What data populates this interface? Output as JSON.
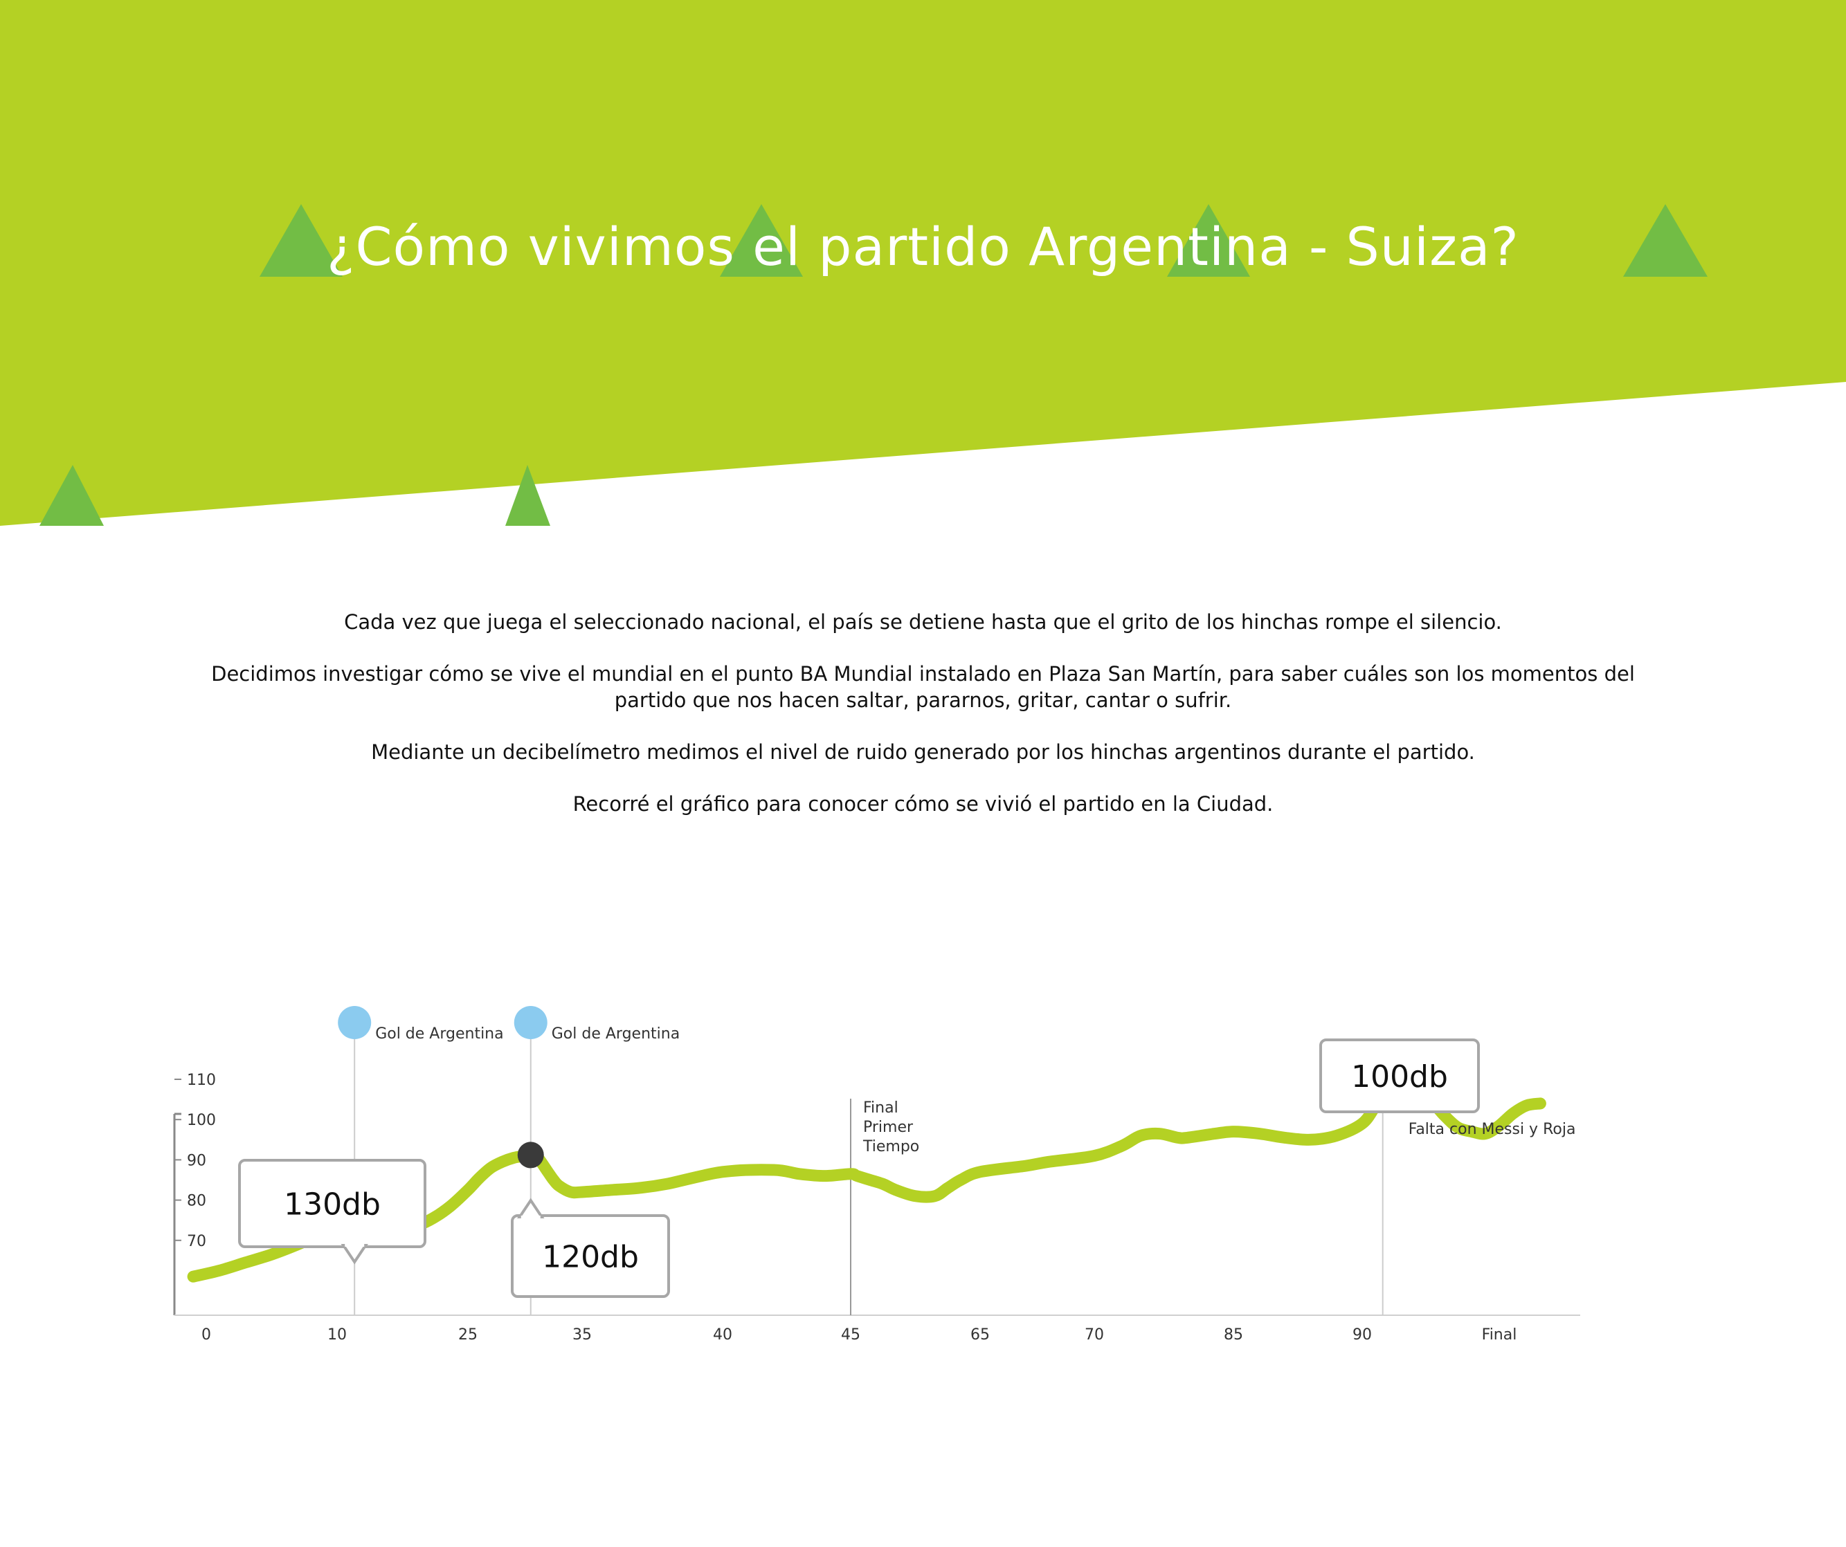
{
  "page": {
    "title": "¿Cómo vivimos el partido Argentina - Suiza?",
    "intro": [
      "Cada vez que juega el seleccionado nacional, el país se detiene hasta que el grito de los hinchas rompe el silencio.",
      "Decidimos investigar cómo se vive el mundial en el punto BA Mundial instalado en Plaza San Martín, para saber cuáles son los momentos del partido que nos hacen saltar, pararnos, gritar, cantar o sufrir.",
      "Mediante un decibelímetro medimos el nivel de ruido generado por los hinchas argentinos durante el partido.",
      "Recorré el gráfico para conocer cómo se vivió el partido en la Ciudad."
    ]
  },
  "colors": {
    "banner": "#b4d124",
    "triangle": "#72bd45",
    "line": "#b4d124",
    "goal_marker": "#8bcbef",
    "point_marker": "#3a3a3a",
    "foul_marker": "#d1213b",
    "callout_border": "#a7a7a7",
    "axis": "#888888",
    "gridline": "#cccccc"
  },
  "chart_data": {
    "type": "line",
    "title": "",
    "xlabel": "",
    "ylabel": "",
    "x_ticks": [
      "0",
      "10",
      "25",
      "35",
      "40",
      "45",
      "65",
      "70",
      "85",
      "90",
      "Final"
    ],
    "y_ticks": [
      "70",
      "80",
      "90",
      "100",
      "110"
    ],
    "ylim": [
      60,
      110
    ],
    "series": [
      {
        "x": [
          -1,
          1,
          3,
          5,
          7,
          8,
          9,
          9.5,
          10,
          11,
          12,
          13,
          15,
          17,
          19,
          21,
          23,
          25,
          26,
          27,
          28,
          29,
          30,
          30.5,
          31,
          32,
          32.5,
          33,
          34,
          35,
          36,
          37,
          38,
          40,
          42,
          43,
          44,
          45,
          46,
          48,
          50,
          52,
          55,
          58,
          60,
          62,
          65,
          67,
          68,
          70,
          73,
          75,
          77,
          79,
          80,
          83,
          85,
          86,
          87,
          88,
          89,
          90,
          91,
          92,
          93,
          94,
          95,
          96,
          97,
          98,
          99,
          100,
          101,
          102,
          103
        ],
        "values": [
          61,
          62.5,
          64.5,
          66.5,
          69,
          70.5,
          72,
          73,
          74,
          75.5,
          76,
          75.5,
          73.5,
          72.5,
          73.5,
          75.5,
          78.5,
          82.5,
          85.5,
          88,
          89.5,
          90.5,
          91,
          91.2,
          91,
          87,
          85,
          83.5,
          82,
          82,
          82.5,
          83,
          84,
          87,
          87.5,
          86.5,
          86,
          86.5,
          86,
          85,
          84,
          82.5,
          81,
          81,
          83,
          85,
          87,
          88.5,
          89.5,
          91,
          93.5,
          96,
          96.5,
          95.5,
          95.5,
          96.5,
          97,
          96.5,
          95.5,
          95,
          96,
          99,
          103.5,
          108,
          110,
          109,
          105,
          101,
          98,
          97,
          96.5,
          98.5,
          101.5,
          103.5,
          104
        ]
      }
    ],
    "events": [
      {
        "label": "Gol de Argentina",
        "x": 12,
        "y": 75.5,
        "callout": "130db",
        "kind": "goal"
      },
      {
        "label": "Gol de Argentina",
        "x": 30.5,
        "y": 91.2,
        "callout": "120db",
        "kind": "goal"
      },
      {
        "label": "Final\nPrimer\nTiempo",
        "x": 45,
        "kind": "halftime"
      },
      {
        "label": "Falta con Messi y Roja",
        "x": 91.5,
        "y": 109.5,
        "callout": "100db",
        "kind": "foul"
      }
    ],
    "grid": false,
    "legend": "none"
  }
}
